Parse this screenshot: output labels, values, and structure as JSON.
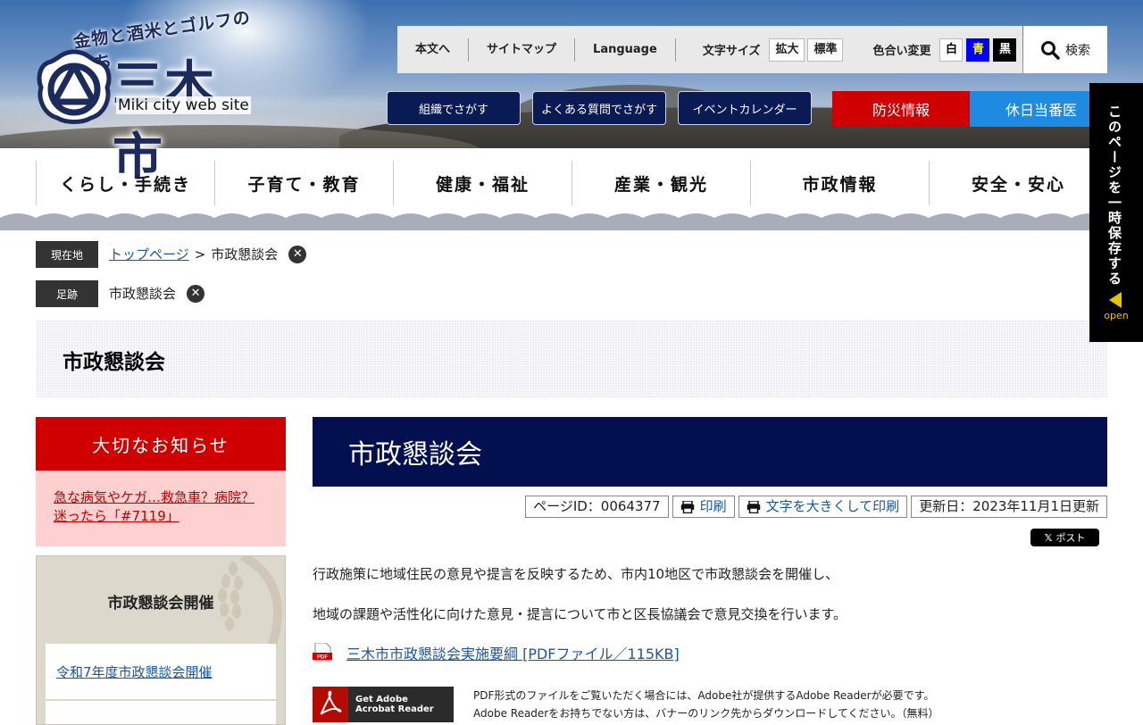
{
  "header": {
    "logo_tagline": "金物と酒米とゴルフのまち",
    "logo_name": "三木市",
    "logo_sub": "Miki city web site",
    "utility_links": [
      "本文へ",
      "サイトマップ",
      "Language"
    ],
    "font_size_label": "文字サイズ",
    "font_size_buttons": [
      "拡大",
      "標準"
    ],
    "color_label": "色合い変更",
    "color_buttons": [
      "白",
      "青",
      "黒"
    ],
    "search_label": "検索",
    "find_buttons": [
      "組織でさがす",
      "よくある質問でさがす",
      "イベントカレンダー"
    ],
    "bousai_label": "防災情報",
    "kyujitsu_label": "休日当番医"
  },
  "global_nav": [
    "くらし・手続き",
    "子育て・教育",
    "健康・福祉",
    "産業・観光",
    "市政情報",
    "安全・安心"
  ],
  "breadcrumb": {
    "current_label": "現在地",
    "home_link": "トップページ",
    "separator": ">",
    "current_page": "市政懇談会",
    "history_label": "足跡",
    "history_item": "市政懇談会"
  },
  "page_title": "市政懇談会",
  "sidebar": {
    "notice_title": "大切なお知らせ",
    "notice_link_line1": "急な病気やケガ…救急車？病院？",
    "notice_link_line2": "迷ったら「#7119」",
    "subnav_title": "市政懇談会開催",
    "subnav_items": [
      "令和7年度市政懇談会開催"
    ]
  },
  "main": {
    "heading": "市政懇談会",
    "page_id": "ページID：0064377",
    "print_label": "印刷",
    "print_large_label": "文字を大きくして印刷",
    "updated": "更新日：2023年11月1日更新",
    "x_post_label": "ポスト",
    "paragraph1": "行政施策に地域住民の意見や提言を反映するため、市内10地区で市政懇談会を開催し、",
    "paragraph2": "地域の課題や活性化に向けた意見・提言について市と区長協議会で意見交換を行います。",
    "pdf_link": "三木市市政懇談会実施要綱 [PDFファイル／115KB]",
    "acrobat_label_line1": "Get Adobe",
    "acrobat_label_line2": "Acrobat Reader",
    "pdf_note1": "PDF形式のファイルをご覧いただく場合には、Adobe社が提供するAdobe Readerが必要です。",
    "pdf_note2": "Adobe Readerをお持ちでない方は、バナーのリンク先からダウンロードしてください。（無料）"
  },
  "save_tab": {
    "label": "このページを一時保存する",
    "open_label": "open"
  },
  "colors": {
    "navy": "#03104f",
    "red": "#d10000",
    "blue_button": "#1e8ae0",
    "link": "#1a55a6",
    "notice_bg": "#ffd0d0"
  }
}
